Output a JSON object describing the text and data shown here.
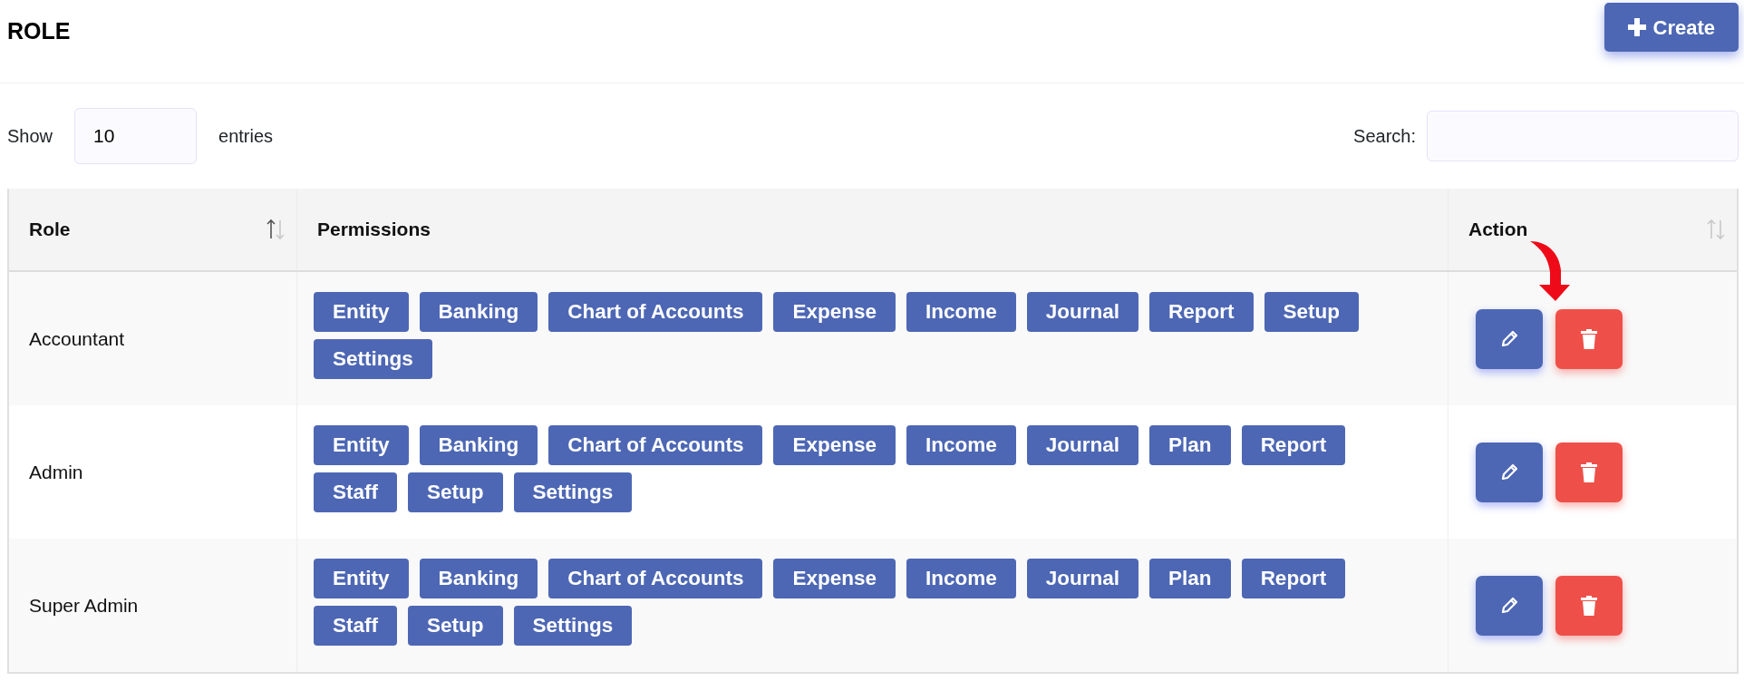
{
  "page": {
    "title": "ROLE",
    "create_button": "Create"
  },
  "length_control": {
    "prefix": "Show",
    "value": "10",
    "suffix": "entries"
  },
  "search": {
    "label": "Search:"
  },
  "table": {
    "columns": [
      {
        "label": "Role",
        "sortable": true,
        "sorted": true
      },
      {
        "label": "Permissions",
        "sortable": false
      },
      {
        "label": "Action",
        "sortable": true,
        "sorted": false
      }
    ],
    "rows": [
      {
        "role": "Accountant",
        "permissions": [
          "Entity",
          "Banking",
          "Chart of Accounts",
          "Expense",
          "Income",
          "Journal",
          "Report",
          "Setup",
          "Settings"
        ]
      },
      {
        "role": "Admin",
        "permissions": [
          "Entity",
          "Banking",
          "Chart of Accounts",
          "Expense",
          "Income",
          "Journal",
          "Plan",
          "Report",
          "Staff",
          "Setup",
          "Settings"
        ]
      },
      {
        "role": "Super Admin",
        "permissions": [
          "Entity",
          "Banking",
          "Chart of Accounts",
          "Expense",
          "Income",
          "Journal",
          "Plan",
          "Report",
          "Staff",
          "Setup",
          "Settings"
        ]
      }
    ]
  }
}
